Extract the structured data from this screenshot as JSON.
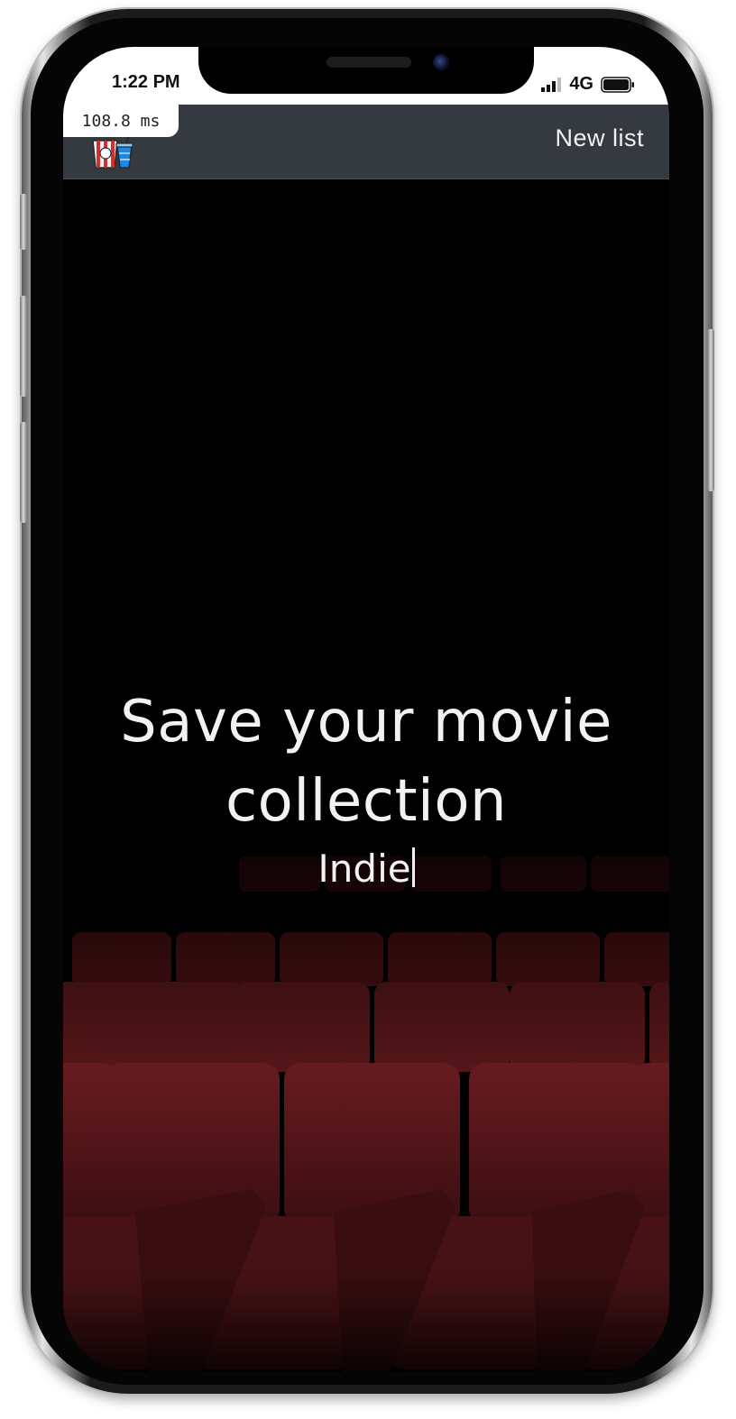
{
  "status_bar": {
    "time": "1:22 PM",
    "network": "4G",
    "signal_icon": "cellular-signal-icon",
    "battery_icon": "battery-full-icon"
  },
  "perf_overlay": {
    "label": "108.8 ms"
  },
  "navbar": {
    "logo_icon": "popcorn-soda-logo-icon",
    "new_list_label": "New list",
    "background": "#343a40"
  },
  "hero": {
    "title": "Save your movie collection",
    "typed_text": "Indie",
    "background_image": "red-cinema-seats",
    "seat_color": "#6e1c20"
  }
}
